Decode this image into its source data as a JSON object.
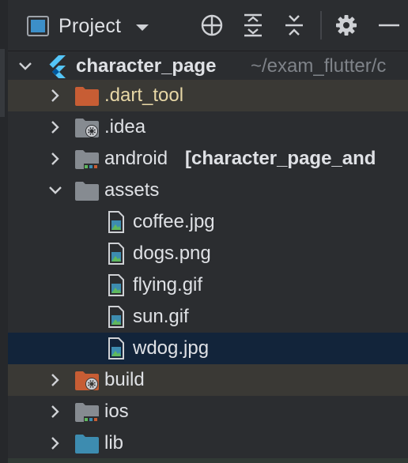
{
  "toolbar": {
    "view_label": "Project",
    "view_icon": "project-panel-icon",
    "buttons": [
      "crosshair-icon",
      "expand-all-icon",
      "collapse-all-icon",
      "gear-icon",
      "minimize-icon"
    ]
  },
  "tree": {
    "root": {
      "name": "character_page",
      "path": "~/exam_flutter/c",
      "icon": "flutter-icon"
    },
    "items": [
      {
        "name": ".dart_tool",
        "icon": "excluded-folder-icon",
        "state": "collapsed"
      },
      {
        "name": ".idea",
        "icon": "settings-folder-icon",
        "state": "collapsed"
      },
      {
        "name": "android",
        "module_suffix": "[character_page_and",
        "icon": "module-folder-icon",
        "state": "collapsed"
      },
      {
        "name": "assets",
        "icon": "folder-icon",
        "state": "expanded"
      },
      {
        "name": "coffee.jpg",
        "icon": "image-file-icon"
      },
      {
        "name": "dogs.png",
        "icon": "image-file-icon"
      },
      {
        "name": "flying.gif",
        "icon": "image-file-icon"
      },
      {
        "name": "sun.gif",
        "icon": "image-file-icon"
      },
      {
        "name": "wdog.jpg",
        "icon": "image-file-icon",
        "selected": true
      },
      {
        "name": "build",
        "icon": "excluded-build-folder-icon",
        "state": "collapsed"
      },
      {
        "name": "ios",
        "icon": "module-folder-icon",
        "state": "collapsed"
      },
      {
        "name": "lib",
        "icon": "source-folder-icon",
        "state": "collapsed"
      }
    ]
  },
  "colors": {
    "background": "#2b2d30",
    "selection": "#12243a",
    "excluded_row": "#3a3935",
    "excluded_folder": "#c75d34",
    "source_folder": "#3d8cb0",
    "flutter_blue": "#54c5f8"
  }
}
